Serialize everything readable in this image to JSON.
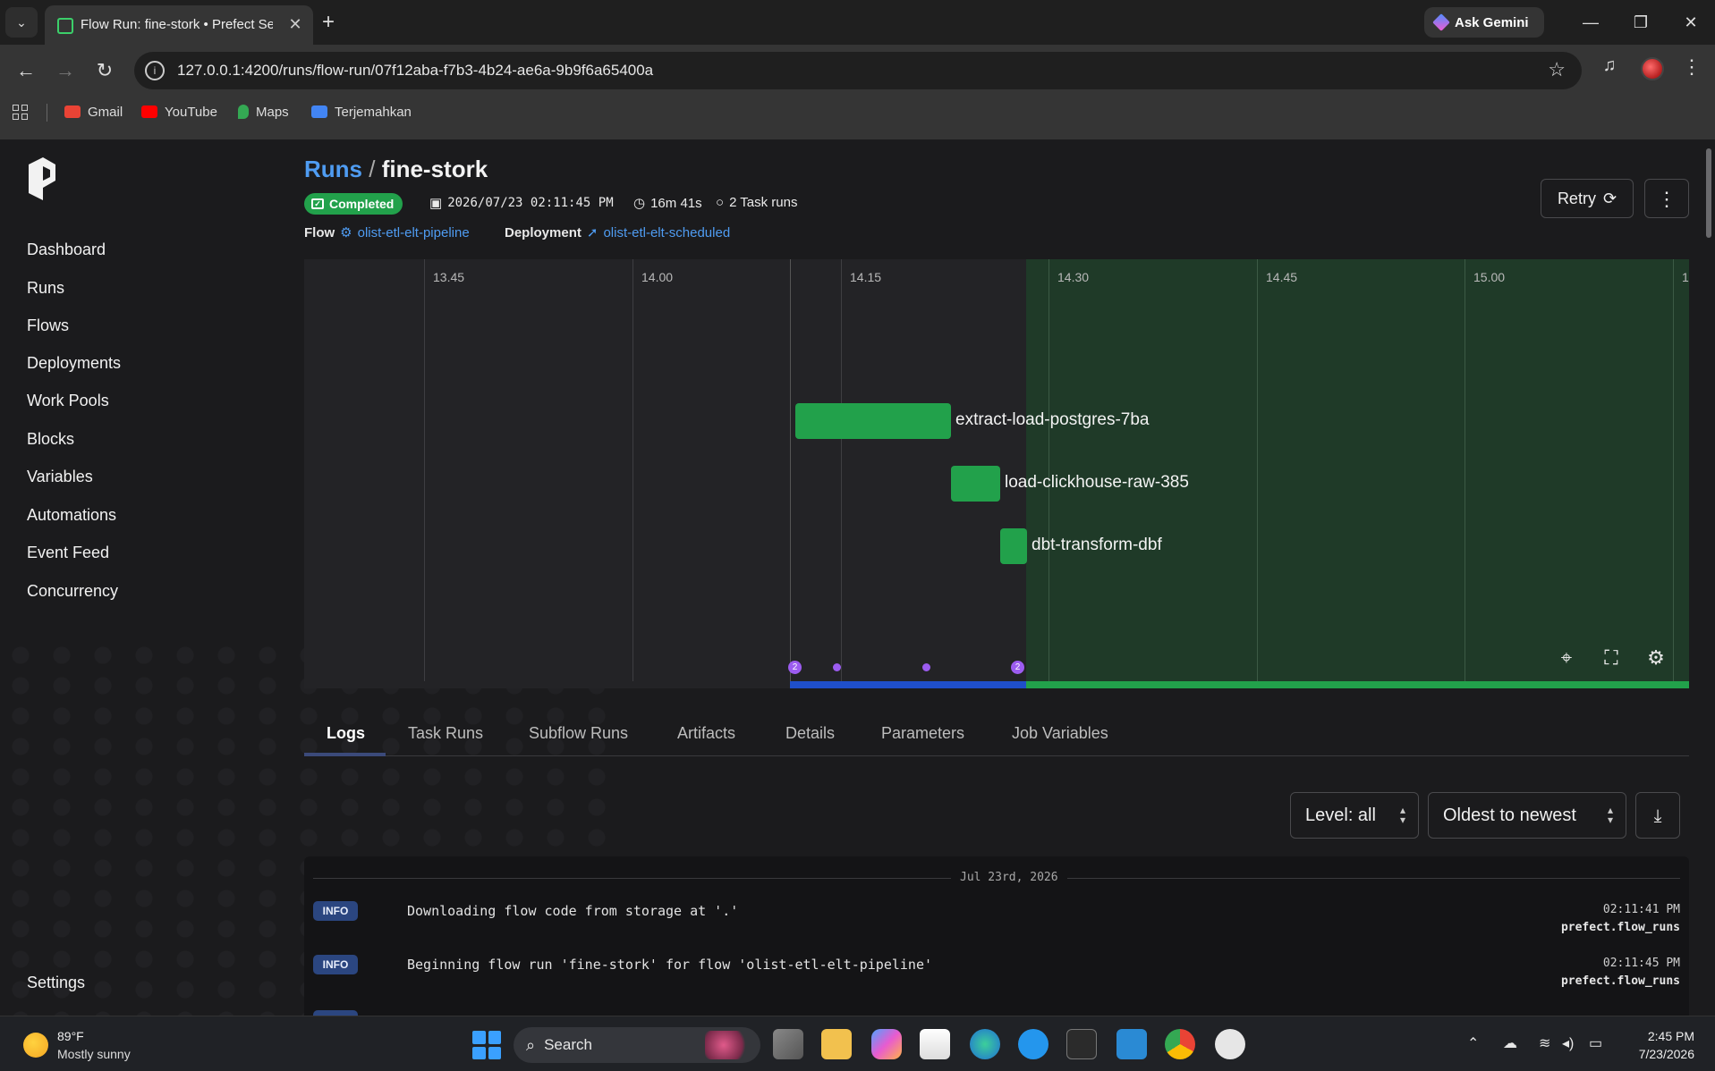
{
  "browser": {
    "tab_title": "Flow Run: fine-stork • Prefect Se",
    "url": "127.0.0.1:4200/runs/flow-run/07f12aba-f7b3-4b24-ae6a-9b9f6a65400a",
    "gemini_label": "Ask Gemini",
    "bookmarks": [
      {
        "label": "Gmail",
        "color": "#ea4335"
      },
      {
        "label": "YouTube",
        "color": "#ff0000"
      },
      {
        "label": "Maps",
        "color": "#34a853"
      },
      {
        "label": "Terjemahkan",
        "color": "#4285f4"
      }
    ]
  },
  "sidebar": {
    "items": [
      "Dashboard",
      "Runs",
      "Flows",
      "Deployments",
      "Work Pools",
      "Blocks",
      "Variables",
      "Automations",
      "Event Feed",
      "Concurrency"
    ],
    "settings": "Settings"
  },
  "header": {
    "breadcrumb_root": "Runs",
    "breadcrumb_sep": "/",
    "run_name": "fine-stork",
    "status": "Completed",
    "start_time": "2026/07/23 02:11:45 PM",
    "duration": "16m 41s",
    "task_runs": "2 Task runs",
    "flow_label": "Flow",
    "flow_name": "olist-etl-elt-pipeline",
    "deployment_label": "Deployment",
    "deployment_name": "olist-etl-elt-scheduled",
    "retry_label": "Retry",
    "colors": {
      "accent": "#4f9cf2",
      "success": "#22a14b"
    }
  },
  "timeline": {
    "ticks": [
      "13.45",
      "14.00",
      "14.15",
      "14.30",
      "14.45",
      "15.00",
      "1"
    ],
    "tasks": [
      "extract-load-postgres-7ba",
      "load-clickhouse-raw-385",
      "dbt-transform-dbf"
    ],
    "event_counts": [
      "2",
      "2"
    ]
  },
  "tabs": [
    "Logs",
    "Task Runs",
    "Subflow Runs",
    "Artifacts",
    "Details",
    "Parameters",
    "Job Variables"
  ],
  "log_controls": {
    "level": "Level: all",
    "order": "Oldest to newest"
  },
  "logs": {
    "date": "Jul 23rd, 2026",
    "entries": [
      {
        "level": "INFO",
        "message": "Downloading flow code from storage at '.'",
        "time": "02:11:41 PM",
        "logger": "prefect.flow_runs"
      },
      {
        "level": "INFO",
        "message": "Beginning flow run 'fine-stork' for flow 'olist-etl-elt-pipeline'",
        "time": "02:11:45 PM",
        "logger": "prefect.flow_runs"
      }
    ]
  },
  "taskbar": {
    "temperature": "89°F",
    "weather": "Mostly sunny",
    "search_label": "Search",
    "time": "2:45 PM",
    "date": "7/23/2026"
  }
}
